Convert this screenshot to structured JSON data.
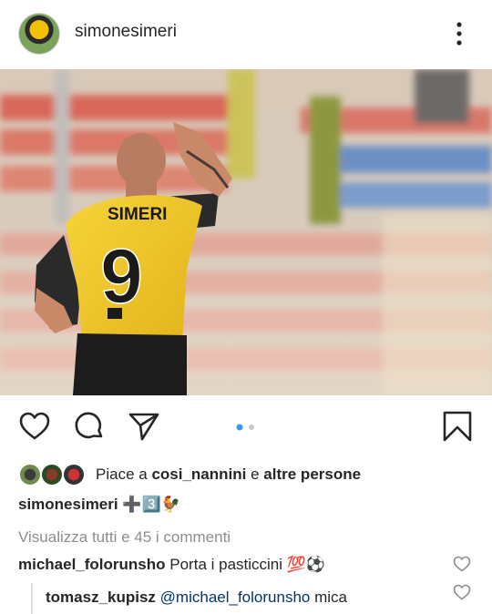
{
  "post": {
    "username": "simonesimeri",
    "photo": {
      "jersey_name": "SIMERI",
      "jersey_number": "9",
      "carousel_dots": 2,
      "active_dot": 0
    }
  },
  "actions": {
    "like_icon": "heart-icon",
    "comment_icon": "comment-icon",
    "share_icon": "paper-plane-icon",
    "save_icon": "bookmark-icon"
  },
  "likes": {
    "prefix": "Piace a",
    "user": "cosi_nannini",
    "joiner": "e",
    "others": "altre persone"
  },
  "caption": {
    "username": "simonesimeri",
    "emoji_text": "➕3️⃣🐓"
  },
  "comments": {
    "view_all": "Visualizza tutti e 45 i commenti",
    "items": [
      {
        "username": "michael_folorunsho",
        "text": "Porta i pasticcini 💯⚽"
      }
    ],
    "reply": {
      "username": "tomasz_kupisz",
      "mention": "@michael_folorunsho",
      "text": "mica"
    }
  },
  "colors": {
    "text": "#262626",
    "muted": "#8e8e8e",
    "link": "#00376b",
    "active_dot": "#3897f0",
    "inactive_dot": "#c7c7c7"
  }
}
